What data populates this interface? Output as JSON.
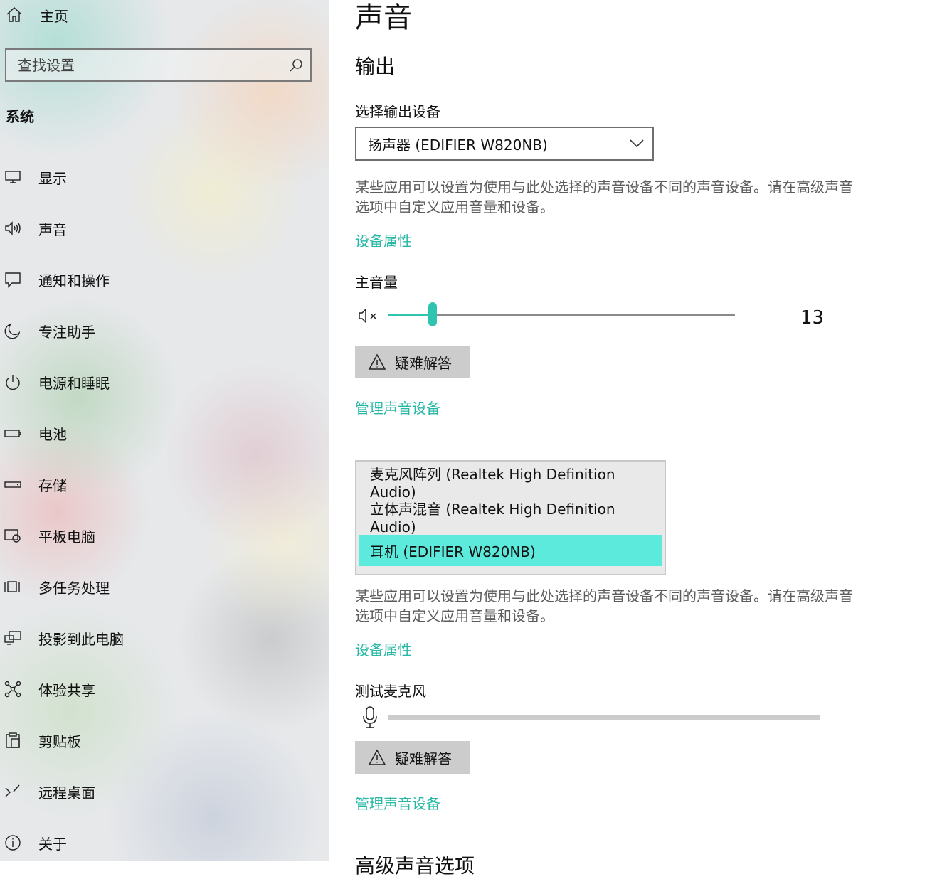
{
  "sidebar": {
    "home_label": "主页",
    "search_placeholder": "查找设置",
    "section_heading": "系统",
    "items": [
      {
        "label": "显示",
        "icon": "monitor-icon"
      },
      {
        "label": "声音",
        "icon": "speaker-icon"
      },
      {
        "label": "通知和操作",
        "icon": "notification-icon"
      },
      {
        "label": "专注助手",
        "icon": "moon-icon"
      },
      {
        "label": "电源和睡眠",
        "icon": "power-icon"
      },
      {
        "label": "电池",
        "icon": "battery-icon"
      },
      {
        "label": "存储",
        "icon": "storage-icon"
      },
      {
        "label": "平板电脑",
        "icon": "tablet-icon"
      },
      {
        "label": "多任务处理",
        "icon": "multitask-icon"
      },
      {
        "label": "投影到此电脑",
        "icon": "project-icon"
      },
      {
        "label": "体验共享",
        "icon": "share-icon"
      },
      {
        "label": "剪贴板",
        "icon": "clipboard-icon"
      },
      {
        "label": "远程桌面",
        "icon": "remote-desktop-icon"
      },
      {
        "label": "关于",
        "icon": "info-icon"
      }
    ]
  },
  "main": {
    "title": "声音",
    "output": {
      "heading": "输出",
      "select_label": "选择输出设备",
      "selected_device": "扬声器 (EDIFIER W820NB)",
      "description": "某些应用可以设置为使用与此处选择的声音设备不同的声音设备。请在高级声音选项中自定义应用音量和设备。",
      "device_properties_link": "设备属性",
      "volume_label": "主音量",
      "volume_value": "13",
      "volume_fraction": 0.13,
      "troubleshoot_label": "疑难解答",
      "manage_devices_link": "管理声音设备"
    },
    "input": {
      "dropdown_options": [
        "麦克风阵列 (Realtek High Definition Audio)",
        "立体声混音 (Realtek High Definition Audio)",
        "耳机 (EDIFIER W820NB)"
      ],
      "selected_index": 2,
      "description": "某些应用可以设置为使用与此处选择的声音设备不同的声音设备。请在高级声音选项中自定义应用音量和设备。",
      "device_properties_link": "设备属性",
      "test_mic_label": "测试麦克风",
      "mic_level": 0,
      "troubleshoot_label": "疑难解答",
      "manage_devices_link": "管理声音设备"
    },
    "advanced_heading": "高级声音选项"
  },
  "colors": {
    "accent": "#2ec4b0",
    "link": "#29b8a5",
    "dropdown_highlight": "#5ceadc"
  }
}
